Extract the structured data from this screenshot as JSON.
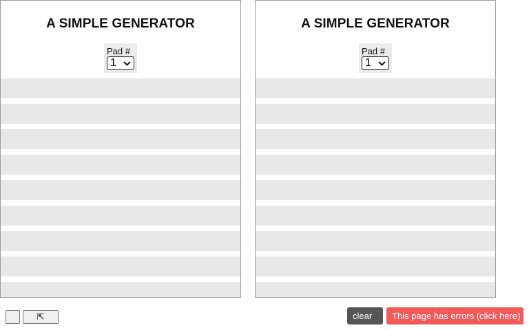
{
  "panels": [
    {
      "title": "A SIMPLE GENERATOR",
      "pad_label": "Pad #",
      "pad_value": "1"
    },
    {
      "title": "A SIMPLE GENERATOR",
      "pad_label": "Pad #",
      "pad_value": "1"
    }
  ],
  "footer": {
    "small_button_glyph": "",
    "expand_button_glyph": "⇱",
    "clear_icon_glyph": "",
    "clear_label": "clear",
    "errors_label": "This page has errors (click here)"
  },
  "colors": {
    "row_fill": "#e8e8e8",
    "clear_bg": "#555555",
    "errors_bg": "#f25a5a"
  }
}
